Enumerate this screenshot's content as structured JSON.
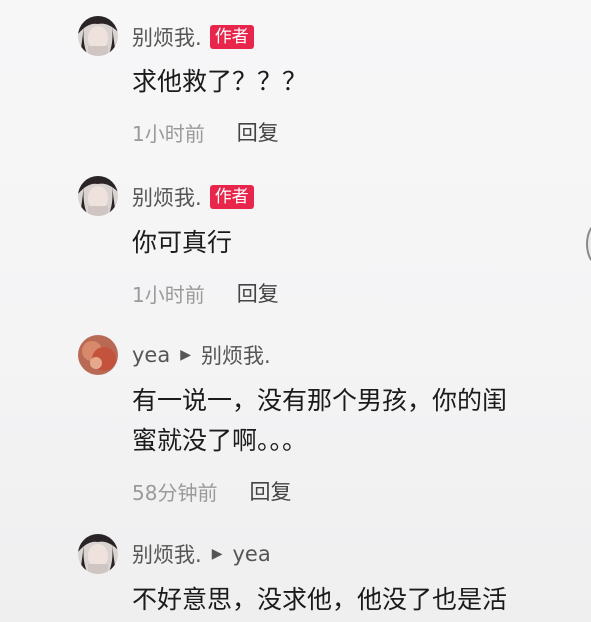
{
  "comments": [
    {
      "username": "别烦我.",
      "badge": "作者",
      "content": "求他救了？？？",
      "time": "1小时前",
      "reply_label": "回复"
    },
    {
      "username": "别烦我.",
      "badge": "作者",
      "content": "你可真行",
      "time": "1小时前",
      "reply_label": "回复"
    },
    {
      "username": "yea",
      "reply_to": "别烦我.",
      "content_line1": "有一说一，没有那个男孩，你的闺",
      "content_line2": "蜜就没了啊。。。",
      "time": "58分钟前",
      "reply_label": "回复"
    },
    {
      "username": "别烦我.",
      "reply_to": "yea",
      "content": "不好意思，没求他，他没了也是活"
    }
  ],
  "icons": {
    "reply_arrow": "reply-to-arrow-icon",
    "avatar_girl": "avatar-girl-photo",
    "avatar_orange": "avatar-orange-photo"
  },
  "colors": {
    "badge": "#e8264b",
    "username": "#555555",
    "time": "#9a9a9a"
  }
}
